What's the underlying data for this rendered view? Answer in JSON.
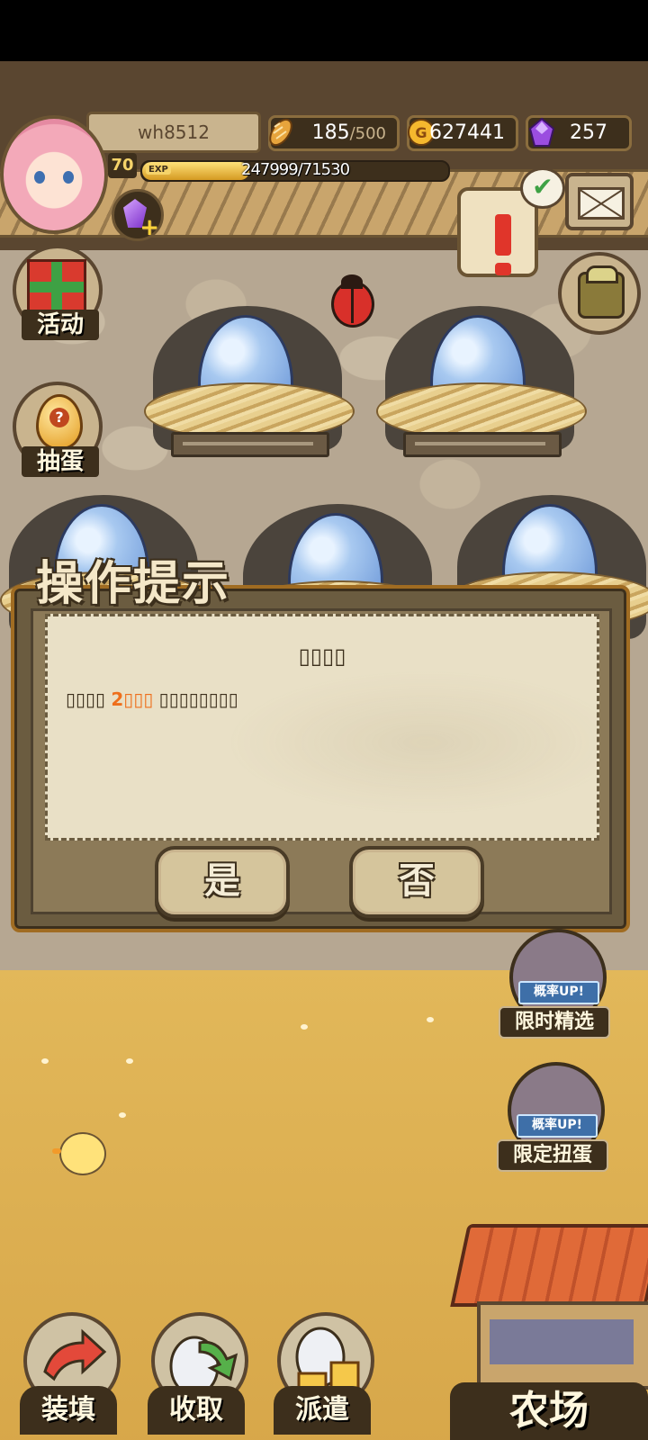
{
  "player": {
    "name": "wh8512",
    "level": "70",
    "exp_label": "EXP",
    "exp_text": "247999/71530",
    "exp_fraction": 0.35
  },
  "resources": {
    "stamina_value": "185",
    "stamina_max": "/500",
    "gold": "627441",
    "gems": "257"
  },
  "side_menu": {
    "activity_label": "活动",
    "gacha_label": "抽蛋"
  },
  "dialog": {
    "title": "操作提示",
    "heading": "▯▯▯▯",
    "message_prefix": "▯▯▯▯ ",
    "message_highlight": "2▯▯▯",
    "message_suffix": " ▯▯▯▯▯▯▯▯",
    "yes_label": "是",
    "no_label": "否"
  },
  "banners": {
    "rate_up_text": "概率UP!",
    "limited_pick_label": "限时精选",
    "limited_gacha_label": "限定扭蛋"
  },
  "bottom_nav": {
    "load_label": "装填",
    "collect_label": "收取",
    "dispatch_label": "派遣",
    "farm_label": "农场"
  },
  "colors": {
    "highlight": "#ee6f1c",
    "frame_brown": "#3d2f1c",
    "paper": "#e9e0c6"
  }
}
